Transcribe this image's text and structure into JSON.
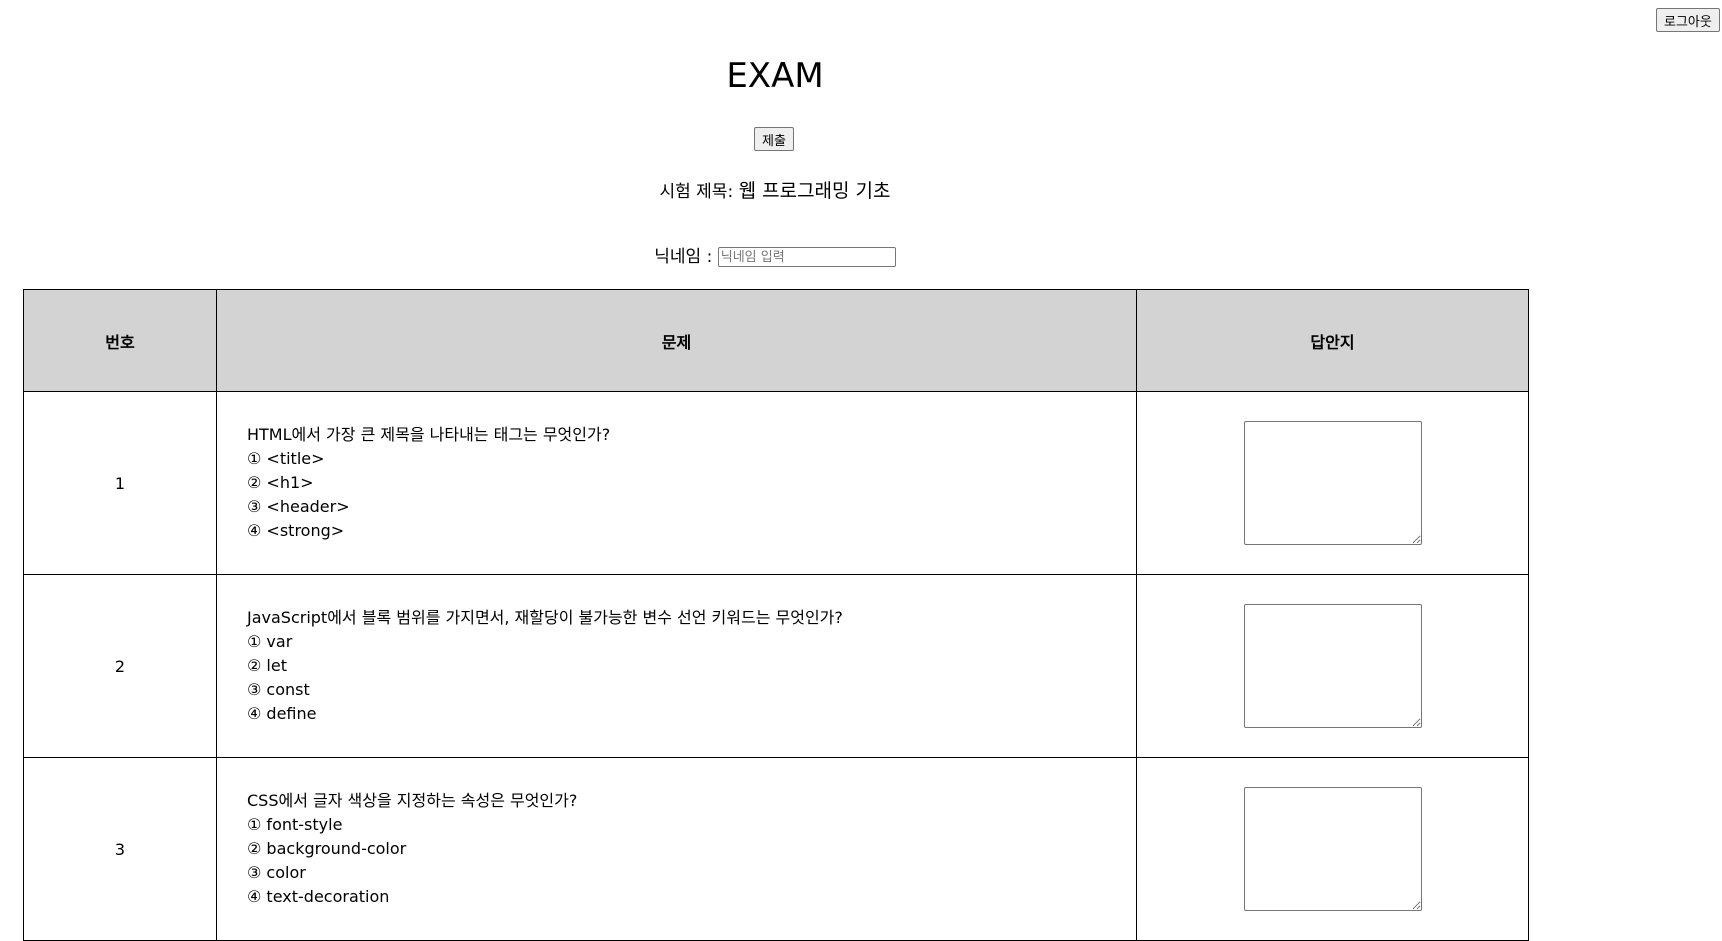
{
  "header": {
    "logout_label": "로그아웃",
    "title": "EXAM",
    "submit_label": "제출"
  },
  "exam": {
    "title_label": "시험 제목:",
    "title_value": "웹 프로그래밍 기초"
  },
  "nickname": {
    "label": "닉네임 :",
    "placeholder": "닉네임 입력",
    "value": ""
  },
  "table": {
    "headers": {
      "number": "번호",
      "question": "문제",
      "answer": "답안지"
    },
    "rows": [
      {
        "number": "1",
        "question": "HTML에서 가장 큰 제목을 나타내는 태그는 무엇인가?",
        "options": [
          "① <title>",
          "② <h1>",
          "③ <header>",
          "④ <strong>"
        ],
        "answer": ""
      },
      {
        "number": "2",
        "question": "JavaScript에서 블록 범위를 가지면서, 재할당이 불가능한 변수 선언 키워드는 무엇인가?",
        "options": [
          "① var",
          "② let",
          "③ const",
          "④ define"
        ],
        "answer": ""
      },
      {
        "number": "3",
        "question": "CSS에서 글자 색상을 지정하는 속성은 무엇인가?",
        "options": [
          "① font-style",
          "② background-color",
          "③ color",
          "④ text-decoration"
        ],
        "answer": ""
      }
    ]
  }
}
